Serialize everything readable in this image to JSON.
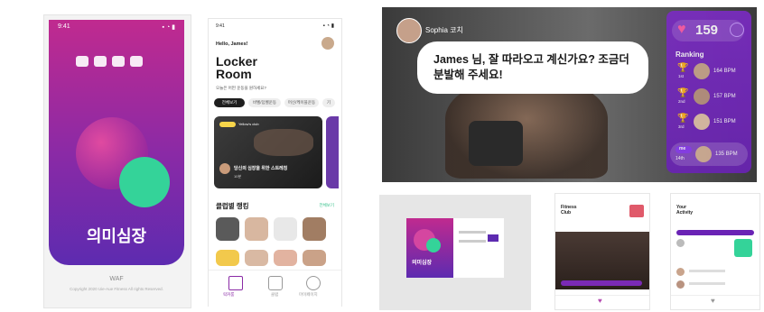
{
  "splash": {
    "status_time": "9:41",
    "app_name": "의미심장",
    "footer_brand": "WAF",
    "copyright": "Copyright 2020 Uie-Aue Fitness All rights Reserved."
  },
  "locker": {
    "status_time": "9:41",
    "greeting": "Hello, James!",
    "title_line1": "Locker",
    "title_line2": "Room",
    "subtitle": "오늘은 어떤 운동을 원하세요?",
    "chips": [
      "전체보기",
      "바벨/덤벨운동",
      "머신/케이블운동",
      "기"
    ],
    "card_tag": "Yellow's club",
    "card_text": "당신의 심장을 위한 스트레칭",
    "card_sub": "10분",
    "section_title": "클럽별 랭킹",
    "section_link": "전체보기",
    "nav": [
      "락커룸",
      "클럽",
      "마이페이지"
    ]
  },
  "coach": {
    "coach_name": "Sophia 코치",
    "message": "James 님, 잘 따라오고 계신가요? 조금더 분발해 주세요!",
    "hearts": "159",
    "ranking_title": "Ranking",
    "ranks": [
      {
        "place": "1st",
        "bpm": "164 BPM"
      },
      {
        "place": "2nd",
        "bpm": "157 BPM"
      },
      {
        "place": "3rd",
        "bpm": "151 BPM"
      }
    ],
    "me_label": "me",
    "me_place": "14th",
    "me_bpm": "135 BPM"
  },
  "mini_login": {
    "app_name": "의미심장"
  },
  "mini_fitness": {
    "title_line1": "Fitness",
    "title_line2": "Club"
  },
  "mini_activity": {
    "title_line1": "Your",
    "title_line2": "Activity"
  },
  "colors": {
    "brand_pink": "#c02a8f",
    "brand_purple": "#6a23b5",
    "accent_mint": "#34d399"
  }
}
